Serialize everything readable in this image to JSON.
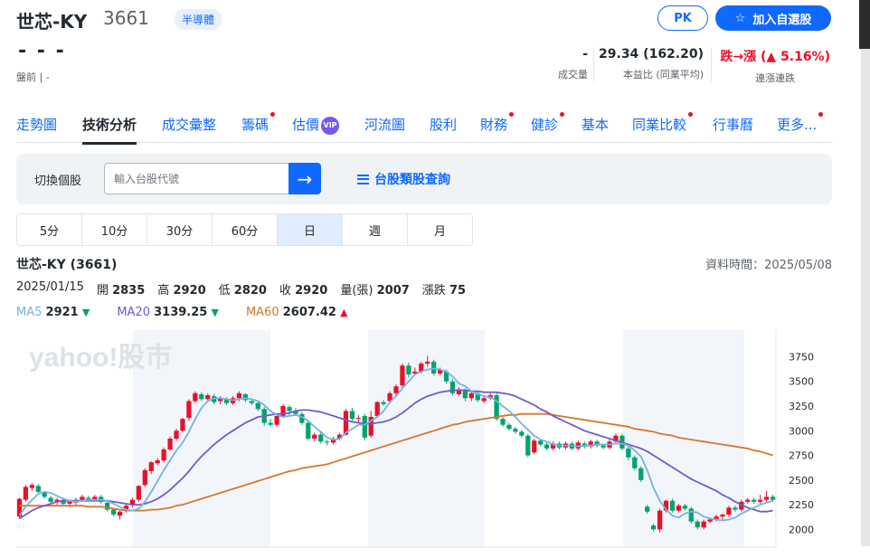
{
  "header": {
    "stock_name": "世芯-KY",
    "stock_code": "3661",
    "sector": "半導體",
    "pk_label": "PK",
    "watchlist_label": "加入自選股"
  },
  "quote": {
    "price": "-  - -",
    "premarket": "盤前 | -",
    "volume_value": "-",
    "volume_label": "成交量",
    "pe_value": "29.34 (162.20)",
    "pe_label": "本益比 (同業平均)",
    "streak_value": "跌→漲 (▲ 5.16%)",
    "streak_label": "連漲連跌"
  },
  "tabs": [
    {
      "label": "走勢圖",
      "dot": false,
      "vip": false
    },
    {
      "label": "技術分析",
      "dot": false,
      "vip": false,
      "active": true
    },
    {
      "label": "成交彙整",
      "dot": false,
      "vip": false
    },
    {
      "label": "籌碼",
      "dot": true,
      "vip": false
    },
    {
      "label": "估價",
      "dot": false,
      "vip": true
    },
    {
      "label": "河流圖",
      "dot": false,
      "vip": false
    },
    {
      "label": "股利",
      "dot": false,
      "vip": false
    },
    {
      "label": "財務",
      "dot": true,
      "vip": false
    },
    {
      "label": "健診",
      "dot": true,
      "vip": false
    },
    {
      "label": "基本",
      "dot": false,
      "vip": false
    },
    {
      "label": "同業比較",
      "dot": true,
      "vip": false
    },
    {
      "label": "行事曆",
      "dot": false,
      "vip": false
    },
    {
      "label": "更多...",
      "dot": true,
      "vip": false
    }
  ],
  "search": {
    "label": "切換個股",
    "placeholder": "輸入台股代號",
    "category_link": "台股類股查詢"
  },
  "intervals": [
    "5分",
    "10分",
    "30分",
    "60分",
    "日",
    "週",
    "月"
  ],
  "active_interval": "日",
  "chart_info": {
    "title": "世芯-KY (3661)",
    "data_time": "資料時間：2025/05/08",
    "date": "2025/01/15",
    "open_label": "開",
    "open": "2835",
    "high_label": "高",
    "high": "2920",
    "low_label": "低",
    "low": "2820",
    "close_label": "收",
    "close": "2920",
    "volume_label": "量(張)",
    "volume": "2007",
    "change_label": "漲跌",
    "change": "75",
    "ma5_label": "MA5",
    "ma5": "2921",
    "ma20_label": "MA20",
    "ma20": "3139.25",
    "ma60_label": "MA60",
    "ma60": "2607.42"
  },
  "watermark": "yahoo!股市",
  "colors": {
    "up": "#eb0f29",
    "down": "#00a36b",
    "ma5": "#71b3e6",
    "ma20": "#7159d1",
    "ma60": "#d7772c",
    "accent": "#0f69ff"
  },
  "chart_data": {
    "type": "candlestick",
    "y_ticks": [
      "3750",
      "3500",
      "3250",
      "3000",
      "2750",
      "2500",
      "2250",
      "2000"
    ],
    "ylim": [
      1820,
      4020
    ],
    "candles": [
      [
        2130,
        2310,
        2110,
        2320
      ],
      [
        2300,
        2430,
        2280,
        2450
      ],
      [
        2420,
        2450,
        2390,
        2470
      ],
      [
        2440,
        2380,
        2360,
        2460
      ],
      [
        2370,
        2330,
        2310,
        2390
      ],
      [
        2320,
        2280,
        2260,
        2340
      ],
      [
        2280,
        2300,
        2250,
        2320
      ],
      [
        2300,
        2260,
        2240,
        2320
      ],
      [
        2260,
        2280,
        2240,
        2300
      ],
      [
        2270,
        2300,
        2250,
        2320
      ],
      [
        2300,
        2330,
        2280,
        2350
      ],
      [
        2320,
        2300,
        2280,
        2340
      ],
      [
        2300,
        2330,
        2280,
        2350
      ],
      [
        2330,
        2280,
        2260,
        2350
      ],
      [
        2270,
        2200,
        2180,
        2290
      ],
      [
        2200,
        2150,
        2130,
        2220
      ],
      [
        2140,
        2180,
        2100,
        2190
      ],
      [
        2190,
        2240,
        2170,
        2260
      ],
      [
        2250,
        2300,
        2220,
        2320
      ],
      [
        2300,
        2440,
        2280,
        2450
      ],
      [
        2450,
        2600,
        2430,
        2620
      ],
      [
        2590,
        2680,
        2560,
        2690
      ],
      [
        2670,
        2700,
        2650,
        2720
      ],
      [
        2700,
        2810,
        2680,
        2830
      ],
      [
        2810,
        2920,
        2800,
        2940
      ],
      [
        2920,
        3000,
        2900,
        3020
      ],
      [
        3000,
        3120,
        2980,
        3130
      ],
      [
        3130,
        3300,
        3100,
        3320
      ],
      [
        3300,
        3380,
        3280,
        3400
      ],
      [
        3370,
        3320,
        3300,
        3390
      ],
      [
        3320,
        3360,
        3300,
        3380
      ],
      [
        3350,
        3290,
        3270,
        3370
      ],
      [
        3300,
        3330,
        3270,
        3350
      ],
      [
        3320,
        3280,
        3260,
        3340
      ],
      [
        3280,
        3330,
        3260,
        3350
      ],
      [
        3330,
        3380,
        3300,
        3400
      ],
      [
        3370,
        3310,
        3290,
        3380
      ],
      [
        3300,
        3280,
        3260,
        3320
      ],
      [
        3280,
        3220,
        3200,
        3300
      ],
      [
        3220,
        3080,
        3050,
        3240
      ],
      [
        3080,
        3060,
        3040,
        3120
      ],
      [
        3060,
        3150,
        3040,
        3170
      ],
      [
        3150,
        3250,
        3130,
        3270
      ],
      [
        3240,
        3200,
        3150,
        3260
      ],
      [
        3200,
        3170,
        3150,
        3230
      ],
      [
        3170,
        3080,
        3060,
        3190
      ],
      [
        3080,
        2920,
        2900,
        3100
      ],
      [
        2920,
        2960,
        2890,
        2980
      ],
      [
        2960,
        2890,
        2870,
        2990
      ],
      [
        2890,
        2880,
        2850,
        2910
      ],
      [
        2880,
        2920,
        2860,
        2940
      ],
      [
        2920,
        2960,
        2900,
        2980
      ],
      [
        2960,
        3200,
        2950,
        3220
      ],
      [
        3200,
        3120,
        3100,
        3230
      ],
      [
        3120,
        3130,
        3080,
        3160
      ],
      [
        3150,
        2930,
        2900,
        3170
      ],
      [
        2950,
        3140,
        2930,
        3200
      ],
      [
        3150,
        3290,
        3130,
        3300
      ],
      [
        3290,
        3270,
        3250,
        3310
      ],
      [
        3300,
        3380,
        3280,
        3400
      ],
      [
        3380,
        3450,
        3360,
        3470
      ],
      [
        3460,
        3660,
        3440,
        3680
      ],
      [
        3660,
        3570,
        3540,
        3690
      ],
      [
        3580,
        3600,
        3560,
        3640
      ],
      [
        3600,
        3680,
        3580,
        3700
      ],
      [
        3680,
        3700,
        3650,
        3760
      ],
      [
        3700,
        3580,
        3560,
        3720
      ],
      [
        3580,
        3620,
        3560,
        3640
      ],
      [
        3600,
        3500,
        3480,
        3620
      ],
      [
        3500,
        3380,
        3360,
        3520
      ],
      [
        3370,
        3420,
        3350,
        3440
      ],
      [
        3410,
        3330,
        3300,
        3430
      ],
      [
        3330,
        3380,
        3300,
        3400
      ],
      [
        3380,
        3310,
        3290,
        3400
      ],
      [
        3300,
        3330,
        3280,
        3350
      ],
      [
        3330,
        3360,
        3310,
        3380
      ],
      [
        3360,
        3120,
        3100,
        3380
      ],
      [
        3120,
        3060,
        3040,
        3140
      ],
      [
        3060,
        3020,
        3000,
        3080
      ],
      [
        3020,
        2990,
        2970,
        3040
      ],
      [
        2990,
        2950,
        2930,
        3010
      ],
      [
        2950,
        2750,
        2730,
        2970
      ],
      [
        2780,
        2900,
        2760,
        2920
      ],
      [
        2900,
        2860,
        2840,
        2920
      ],
      [
        2860,
        2820,
        2800,
        2880
      ],
      [
        2820,
        2870,
        2800,
        2890
      ],
      [
        2870,
        2830,
        2810,
        2890
      ],
      [
        2830,
        2870,
        2810,
        2890
      ],
      [
        2870,
        2820,
        2800,
        2890
      ],
      [
        2820,
        2880,
        2800,
        2900
      ],
      [
        2870,
        2840,
        2820,
        2890
      ],
      [
        2840,
        2890,
        2820,
        2910
      ],
      [
        2890,
        2850,
        2830,
        2910
      ],
      [
        2850,
        2830,
        2810,
        2870
      ],
      [
        2830,
        2890,
        2810,
        2910
      ],
      [
        2890,
        2950,
        2870,
        2970
      ],
      [
        2950,
        2820,
        2800,
        2970
      ],
      [
        2820,
        2730,
        2700,
        2840
      ],
      [
        2730,
        2620,
        2600,
        2750
      ],
      [
        2620,
        2500,
        2480,
        2640
      ],
      [
        2230,
        2180,
        2160,
        2250
      ],
      [
        2040,
        2000,
        1980,
        2060
      ],
      [
        2000,
        2190,
        1970,
        2210
      ],
      [
        2190,
        2290,
        2170,
        2300
      ],
      [
        2290,
        2190,
        2170,
        2310
      ],
      [
        2190,
        2240,
        2170,
        2260
      ],
      [
        2240,
        2210,
        2190,
        2260
      ],
      [
        2210,
        2080,
        2060,
        2230
      ],
      [
        2080,
        2020,
        2000,
        2100
      ],
      [
        2020,
        2080,
        2000,
        2100
      ],
      [
        2080,
        2100,
        2060,
        2120
      ],
      [
        2100,
        2130,
        2080,
        2150
      ],
      [
        2130,
        2150,
        2100,
        2160
      ],
      [
        2150,
        2220,
        2130,
        2240
      ],
      [
        2220,
        2200,
        2180,
        2240
      ],
      [
        2200,
        2280,
        2180,
        2300
      ],
      [
        2280,
        2300,
        2260,
        2320
      ],
      [
        2300,
        2280,
        2260,
        2320
      ],
      [
        2280,
        2300,
        2260,
        2350
      ],
      [
        2300,
        2330,
        2280,
        2390
      ],
      [
        2330,
        2300,
        2280,
        2350
      ]
    ],
    "ma5_series": [
      2140,
      2230,
      2300,
      2360,
      2380,
      2370,
      2340,
      2310,
      2290,
      2280,
      2290,
      2300,
      2300,
      2300,
      2290,
      2260,
      2230,
      2200,
      2190,
      2210,
      2280,
      2380,
      2490,
      2600,
      2700,
      2800,
      2880,
      2990,
      3120,
      3230,
      3300,
      3330,
      3330,
      3320,
      3310,
      3320,
      3330,
      3320,
      3300,
      3260,
      3200,
      3160,
      3140,
      3150,
      3160,
      3140,
      3100,
      3040,
      2990,
      2930,
      2910,
      2920,
      2980,
      3020,
      3060,
      3060,
      3100,
      3140,
      3200,
      3290,
      3350,
      3430,
      3500,
      3570,
      3600,
      3620,
      3630,
      3620,
      3600,
      3550,
      3480,
      3450,
      3400,
      3370,
      3350,
      3340,
      3300,
      3250,
      3200,
      3140,
      3070,
      3010,
      2950,
      2910,
      2890,
      2860,
      2850,
      2850,
      2850,
      2840,
      2850,
      2850,
      2860,
      2860,
      2860,
      2870,
      2870,
      2850,
      2800,
      2740,
      2600,
      2420,
      2290,
      2200,
      2140,
      2120,
      2160,
      2180,
      2170,
      2130,
      2110,
      2100,
      2090,
      2100,
      2120,
      2160,
      2190,
      2220,
      2250,
      2270,
      2290
    ],
    "ma20_series": [
      2110,
      2150,
      2190,
      2220,
      2240,
      2260,
      2280,
      2290,
      2290,
      2290,
      2290,
      2290,
      2290,
      2290,
      2290,
      2280,
      2270,
      2260,
      2250,
      2250,
      2260,
      2280,
      2310,
      2350,
      2400,
      2460,
      2520,
      2590,
      2670,
      2740,
      2800,
      2860,
      2910,
      2960,
      3000,
      3040,
      3080,
      3110,
      3140,
      3150,
      3160,
      3170,
      3170,
      3180,
      3200,
      3210,
      3210,
      3200,
      3190,
      3170,
      3150,
      3130,
      3110,
      3090,
      3080,
      3070,
      3070,
      3080,
      3090,
      3110,
      3140,
      3180,
      3230,
      3280,
      3320,
      3350,
      3370,
      3390,
      3400,
      3410,
      3410,
      3410,
      3400,
      3400,
      3390,
      3390,
      3390,
      3380,
      3370,
      3350,
      3320,
      3290,
      3260,
      3220,
      3190,
      3150,
      3120,
      3090,
      3060,
      3030,
      3000,
      2980,
      2960,
      2940,
      2920,
      2900,
      2880,
      2860,
      2840,
      2820,
      2790,
      2750,
      2710,
      2670,
      2630,
      2590,
      2550,
      2510,
      2480,
      2450,
      2420,
      2390,
      2350,
      2320,
      2280,
      2250,
      2220,
      2200,
      2180,
      2180,
      2190
    ],
    "ma60_series": [
      2240,
      2240,
      2240,
      2240,
      2240,
      2240,
      2240,
      2240,
      2240,
      2240,
      2240,
      2230,
      2230,
      2230,
      2220,
      2210,
      2200,
      2190,
      2190,
      2190,
      2190,
      2200,
      2200,
      2210,
      2220,
      2240,
      2250,
      2270,
      2290,
      2310,
      2330,
      2350,
      2370,
      2390,
      2410,
      2430,
      2450,
      2470,
      2490,
      2510,
      2530,
      2550,
      2570,
      2590,
      2600,
      2620,
      2630,
      2640,
      2650,
      2660,
      2680,
      2700,
      2720,
      2740,
      2760,
      2780,
      2800,
      2820,
      2840,
      2860,
      2880,
      2900,
      2920,
      2940,
      2960,
      2980,
      3000,
      3020,
      3040,
      3060,
      3070,
      3090,
      3100,
      3110,
      3120,
      3130,
      3140,
      3150,
      3160,
      3160,
      3170,
      3170,
      3170,
      3170,
      3170,
      3160,
      3150,
      3140,
      3130,
      3120,
      3110,
      3100,
      3090,
      3080,
      3070,
      3060,
      3050,
      3040,
      3020,
      3010,
      3000,
      2990,
      2970,
      2960,
      2950,
      2930,
      2920,
      2910,
      2900,
      2890,
      2880,
      2870,
      2860,
      2850,
      2840,
      2830,
      2820,
      2800,
      2790,
      2770,
      2750
    ]
  }
}
